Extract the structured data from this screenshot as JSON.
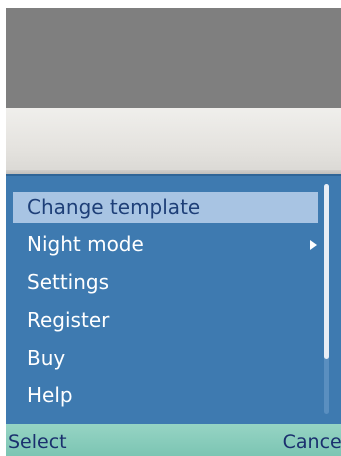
{
  "menu": {
    "items": [
      {
        "label": "Change template",
        "selected": true,
        "has_submenu": false
      },
      {
        "label": "Night mode",
        "selected": false,
        "has_submenu": true
      },
      {
        "label": "Settings",
        "selected": false,
        "has_submenu": false
      },
      {
        "label": "Register",
        "selected": false,
        "has_submenu": false
      },
      {
        "label": "Buy",
        "selected": false,
        "has_submenu": false
      },
      {
        "label": "Help",
        "selected": false,
        "has_submenu": false
      }
    ],
    "submenu_icon": "chevron-right-icon"
  },
  "softkeys": {
    "left_label": "Select",
    "right_label": "Cancel"
  },
  "colors": {
    "menu_background": "#3e7ab0",
    "selected_highlight": "#a8c4e3",
    "softkey_bar": "#7cc5b3",
    "softkey_text": "#1a2f6e"
  }
}
